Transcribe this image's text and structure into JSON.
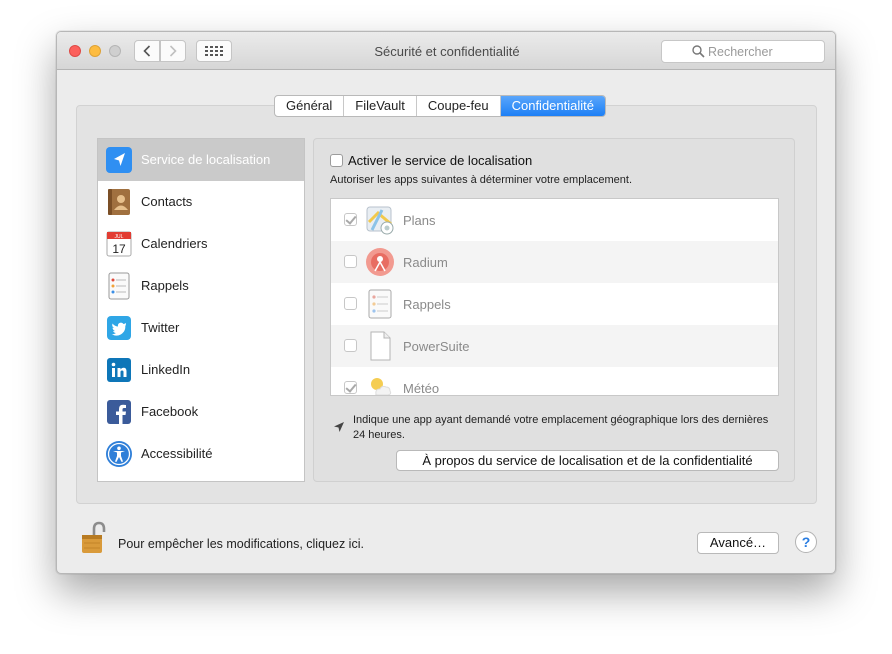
{
  "window": {
    "title": "Sécurité et confidentialité",
    "search_placeholder": "Rechercher"
  },
  "tabs": [
    {
      "label": "Général",
      "active": false
    },
    {
      "label": "FileVault",
      "active": false
    },
    {
      "label": "Coupe-feu",
      "active": false
    },
    {
      "label": "Confidentialité",
      "active": true
    }
  ],
  "sidebar": {
    "items": [
      {
        "label": "Service de localisation",
        "icon": "location-arrow-icon",
        "selected": true
      },
      {
        "label": "Contacts",
        "icon": "contacts-book-icon",
        "selected": false
      },
      {
        "label": "Calendriers",
        "icon": "calendar-icon",
        "selected": false,
        "icon_text": "JUL",
        "icon_day": "17"
      },
      {
        "label": "Rappels",
        "icon": "reminders-icon",
        "selected": false
      },
      {
        "label": "Twitter",
        "icon": "twitter-icon",
        "selected": false
      },
      {
        "label": "LinkedIn",
        "icon": "linkedin-icon",
        "selected": false
      },
      {
        "label": "Facebook",
        "icon": "facebook-icon",
        "selected": false
      },
      {
        "label": "Accessibilité",
        "icon": "accessibility-icon",
        "selected": false
      }
    ]
  },
  "panel": {
    "enable_label": "Activer le service de localisation",
    "enable_checked": false,
    "description": "Autoriser les apps suivantes à déterminer votre emplacement.",
    "apps": [
      {
        "name": "Plans",
        "checked": true,
        "icon": "maps-icon"
      },
      {
        "name": "Radium",
        "checked": false,
        "icon": "radium-icon"
      },
      {
        "name": "Rappels",
        "checked": false,
        "icon": "reminders-icon"
      },
      {
        "name": "PowerSuite",
        "checked": false,
        "icon": "generic-document-icon"
      },
      {
        "name": "Météo",
        "checked": true,
        "icon": "weather-icon"
      }
    ],
    "note": "Indique une app ayant demandé votre emplacement géographique lors des dernières 24 heures.",
    "about_button": "À propos du service de localisation et de la confidentialité"
  },
  "footer": {
    "lock_text": "Pour empêcher les modifications, cliquez ici.",
    "advanced_button": "Avancé…",
    "help_button": "?"
  },
  "colors": {
    "accent": "#1d7ff5",
    "window_bg": "#ececec"
  }
}
